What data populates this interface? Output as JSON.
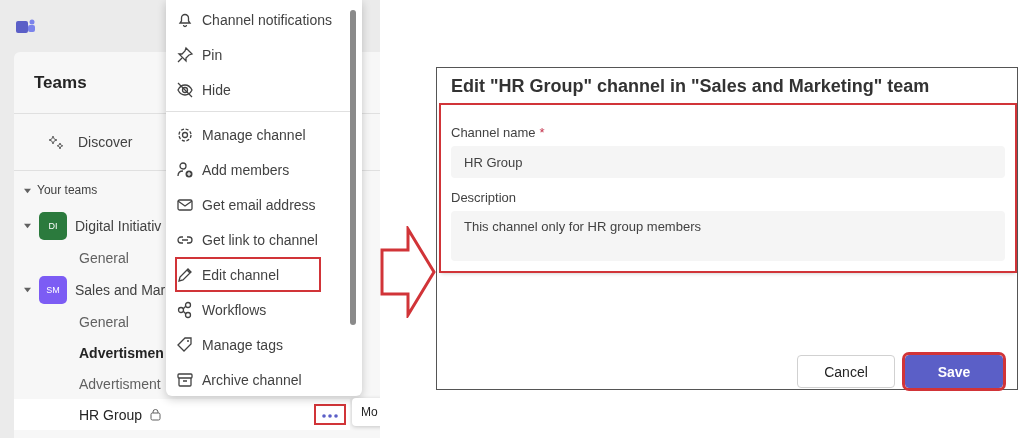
{
  "sidebar": {
    "title": "Teams",
    "discover": "Discover",
    "section": "Your teams",
    "section_expanded": true,
    "teams": [
      {
        "initials": "DI",
        "name": "Digital Initiativ",
        "color": "#2b7a3d",
        "expanded": true,
        "channels": [
          {
            "name": "General",
            "unread": false,
            "selected": false
          }
        ]
      },
      {
        "initials": "SM",
        "name": "Sales and Mar",
        "color": "#7c5cf4",
        "expanded": true,
        "channels": [
          {
            "name": "General",
            "unread": false,
            "selected": false
          },
          {
            "name": "Advertismen",
            "unread": true,
            "selected": false
          },
          {
            "name": "Advertisment",
            "unread": false,
            "selected": false
          },
          {
            "name": "HR Group",
            "unread": false,
            "selected": true,
            "private": true,
            "more_highlighted": true
          }
        ]
      }
    ],
    "tooltip": "Mo"
  },
  "context_menu": {
    "items": [
      {
        "label": "Channel notifications",
        "highlighted": false
      },
      {
        "label": "Pin",
        "highlighted": false
      },
      {
        "label": "Hide",
        "highlighted": false
      },
      {
        "label": "Manage channel",
        "highlighted": false
      },
      {
        "label": "Add members",
        "highlighted": false
      },
      {
        "label": "Get email address",
        "highlighted": false
      },
      {
        "label": "Get link to channel",
        "highlighted": false
      },
      {
        "label": "Edit channel",
        "highlighted": true
      },
      {
        "label": "Workflows",
        "highlighted": false
      },
      {
        "label": "Manage tags",
        "highlighted": false
      },
      {
        "label": "Archive channel",
        "highlighted": false
      }
    ]
  },
  "dialog": {
    "title": "Edit \"HR Group\" channel in \"Sales and Marketing\" team",
    "fields_highlighted": true,
    "fields": [
      {
        "kind": "input",
        "label": "Channel name",
        "required_mark": "*",
        "value": "HR Group"
      },
      {
        "kind": "textarea",
        "label": "Description",
        "value": "This channel only for HR group members"
      }
    ],
    "buttons": [
      {
        "label": "Cancel",
        "primary": false,
        "highlighted": false
      },
      {
        "label": "Save",
        "primary": true,
        "highlighted": true
      }
    ]
  }
}
